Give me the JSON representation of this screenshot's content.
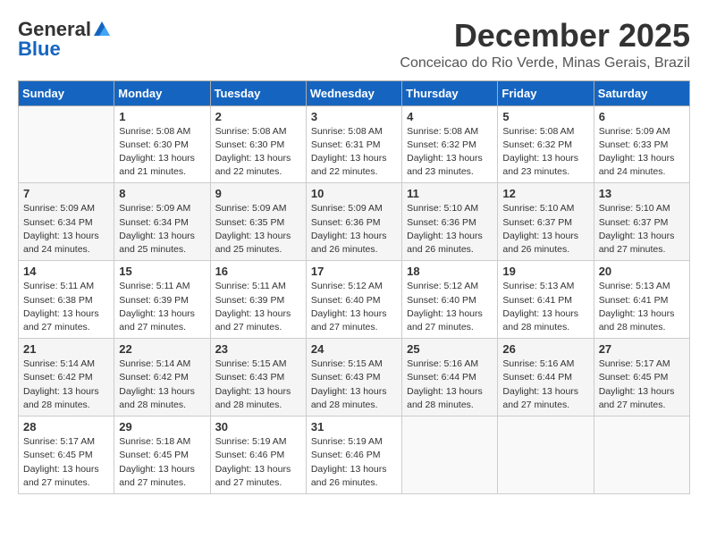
{
  "header": {
    "logo_general": "General",
    "logo_blue": "Blue",
    "month": "December 2025",
    "location": "Conceicao do Rio Verde, Minas Gerais, Brazil"
  },
  "days_of_week": [
    "Sunday",
    "Monday",
    "Tuesday",
    "Wednesday",
    "Thursday",
    "Friday",
    "Saturday"
  ],
  "weeks": [
    [
      {
        "day": "",
        "sunrise": "",
        "sunset": "",
        "daylight": ""
      },
      {
        "day": "1",
        "sunrise": "Sunrise: 5:08 AM",
        "sunset": "Sunset: 6:30 PM",
        "daylight": "Daylight: 13 hours and 21 minutes."
      },
      {
        "day": "2",
        "sunrise": "Sunrise: 5:08 AM",
        "sunset": "Sunset: 6:30 PM",
        "daylight": "Daylight: 13 hours and 22 minutes."
      },
      {
        "day": "3",
        "sunrise": "Sunrise: 5:08 AM",
        "sunset": "Sunset: 6:31 PM",
        "daylight": "Daylight: 13 hours and 22 minutes."
      },
      {
        "day": "4",
        "sunrise": "Sunrise: 5:08 AM",
        "sunset": "Sunset: 6:32 PM",
        "daylight": "Daylight: 13 hours and 23 minutes."
      },
      {
        "day": "5",
        "sunrise": "Sunrise: 5:08 AM",
        "sunset": "Sunset: 6:32 PM",
        "daylight": "Daylight: 13 hours and 23 minutes."
      },
      {
        "day": "6",
        "sunrise": "Sunrise: 5:09 AM",
        "sunset": "Sunset: 6:33 PM",
        "daylight": "Daylight: 13 hours and 24 minutes."
      }
    ],
    [
      {
        "day": "7",
        "sunrise": "Sunrise: 5:09 AM",
        "sunset": "Sunset: 6:34 PM",
        "daylight": "Daylight: 13 hours and 24 minutes."
      },
      {
        "day": "8",
        "sunrise": "Sunrise: 5:09 AM",
        "sunset": "Sunset: 6:34 PM",
        "daylight": "Daylight: 13 hours and 25 minutes."
      },
      {
        "day": "9",
        "sunrise": "Sunrise: 5:09 AM",
        "sunset": "Sunset: 6:35 PM",
        "daylight": "Daylight: 13 hours and 25 minutes."
      },
      {
        "day": "10",
        "sunrise": "Sunrise: 5:09 AM",
        "sunset": "Sunset: 6:36 PM",
        "daylight": "Daylight: 13 hours and 26 minutes."
      },
      {
        "day": "11",
        "sunrise": "Sunrise: 5:10 AM",
        "sunset": "Sunset: 6:36 PM",
        "daylight": "Daylight: 13 hours and 26 minutes."
      },
      {
        "day": "12",
        "sunrise": "Sunrise: 5:10 AM",
        "sunset": "Sunset: 6:37 PM",
        "daylight": "Daylight: 13 hours and 26 minutes."
      },
      {
        "day": "13",
        "sunrise": "Sunrise: 5:10 AM",
        "sunset": "Sunset: 6:37 PM",
        "daylight": "Daylight: 13 hours and 27 minutes."
      }
    ],
    [
      {
        "day": "14",
        "sunrise": "Sunrise: 5:11 AM",
        "sunset": "Sunset: 6:38 PM",
        "daylight": "Daylight: 13 hours and 27 minutes."
      },
      {
        "day": "15",
        "sunrise": "Sunrise: 5:11 AM",
        "sunset": "Sunset: 6:39 PM",
        "daylight": "Daylight: 13 hours and 27 minutes."
      },
      {
        "day": "16",
        "sunrise": "Sunrise: 5:11 AM",
        "sunset": "Sunset: 6:39 PM",
        "daylight": "Daylight: 13 hours and 27 minutes."
      },
      {
        "day": "17",
        "sunrise": "Sunrise: 5:12 AM",
        "sunset": "Sunset: 6:40 PM",
        "daylight": "Daylight: 13 hours and 27 minutes."
      },
      {
        "day": "18",
        "sunrise": "Sunrise: 5:12 AM",
        "sunset": "Sunset: 6:40 PM",
        "daylight": "Daylight: 13 hours and 27 minutes."
      },
      {
        "day": "19",
        "sunrise": "Sunrise: 5:13 AM",
        "sunset": "Sunset: 6:41 PM",
        "daylight": "Daylight: 13 hours and 28 minutes."
      },
      {
        "day": "20",
        "sunrise": "Sunrise: 5:13 AM",
        "sunset": "Sunset: 6:41 PM",
        "daylight": "Daylight: 13 hours and 28 minutes."
      }
    ],
    [
      {
        "day": "21",
        "sunrise": "Sunrise: 5:14 AM",
        "sunset": "Sunset: 6:42 PM",
        "daylight": "Daylight: 13 hours and 28 minutes."
      },
      {
        "day": "22",
        "sunrise": "Sunrise: 5:14 AM",
        "sunset": "Sunset: 6:42 PM",
        "daylight": "Daylight: 13 hours and 28 minutes."
      },
      {
        "day": "23",
        "sunrise": "Sunrise: 5:15 AM",
        "sunset": "Sunset: 6:43 PM",
        "daylight": "Daylight: 13 hours and 28 minutes."
      },
      {
        "day": "24",
        "sunrise": "Sunrise: 5:15 AM",
        "sunset": "Sunset: 6:43 PM",
        "daylight": "Daylight: 13 hours and 28 minutes."
      },
      {
        "day": "25",
        "sunrise": "Sunrise: 5:16 AM",
        "sunset": "Sunset: 6:44 PM",
        "daylight": "Daylight: 13 hours and 28 minutes."
      },
      {
        "day": "26",
        "sunrise": "Sunrise: 5:16 AM",
        "sunset": "Sunset: 6:44 PM",
        "daylight": "Daylight: 13 hours and 27 minutes."
      },
      {
        "day": "27",
        "sunrise": "Sunrise: 5:17 AM",
        "sunset": "Sunset: 6:45 PM",
        "daylight": "Daylight: 13 hours and 27 minutes."
      }
    ],
    [
      {
        "day": "28",
        "sunrise": "Sunrise: 5:17 AM",
        "sunset": "Sunset: 6:45 PM",
        "daylight": "Daylight: 13 hours and 27 minutes."
      },
      {
        "day": "29",
        "sunrise": "Sunrise: 5:18 AM",
        "sunset": "Sunset: 6:45 PM",
        "daylight": "Daylight: 13 hours and 27 minutes."
      },
      {
        "day": "30",
        "sunrise": "Sunrise: 5:19 AM",
        "sunset": "Sunset: 6:46 PM",
        "daylight": "Daylight: 13 hours and 27 minutes."
      },
      {
        "day": "31",
        "sunrise": "Sunrise: 5:19 AM",
        "sunset": "Sunset: 6:46 PM",
        "daylight": "Daylight: 13 hours and 26 minutes."
      },
      {
        "day": "",
        "sunrise": "",
        "sunset": "",
        "daylight": ""
      },
      {
        "day": "",
        "sunrise": "",
        "sunset": "",
        "daylight": ""
      },
      {
        "day": "",
        "sunrise": "",
        "sunset": "",
        "daylight": ""
      }
    ]
  ]
}
